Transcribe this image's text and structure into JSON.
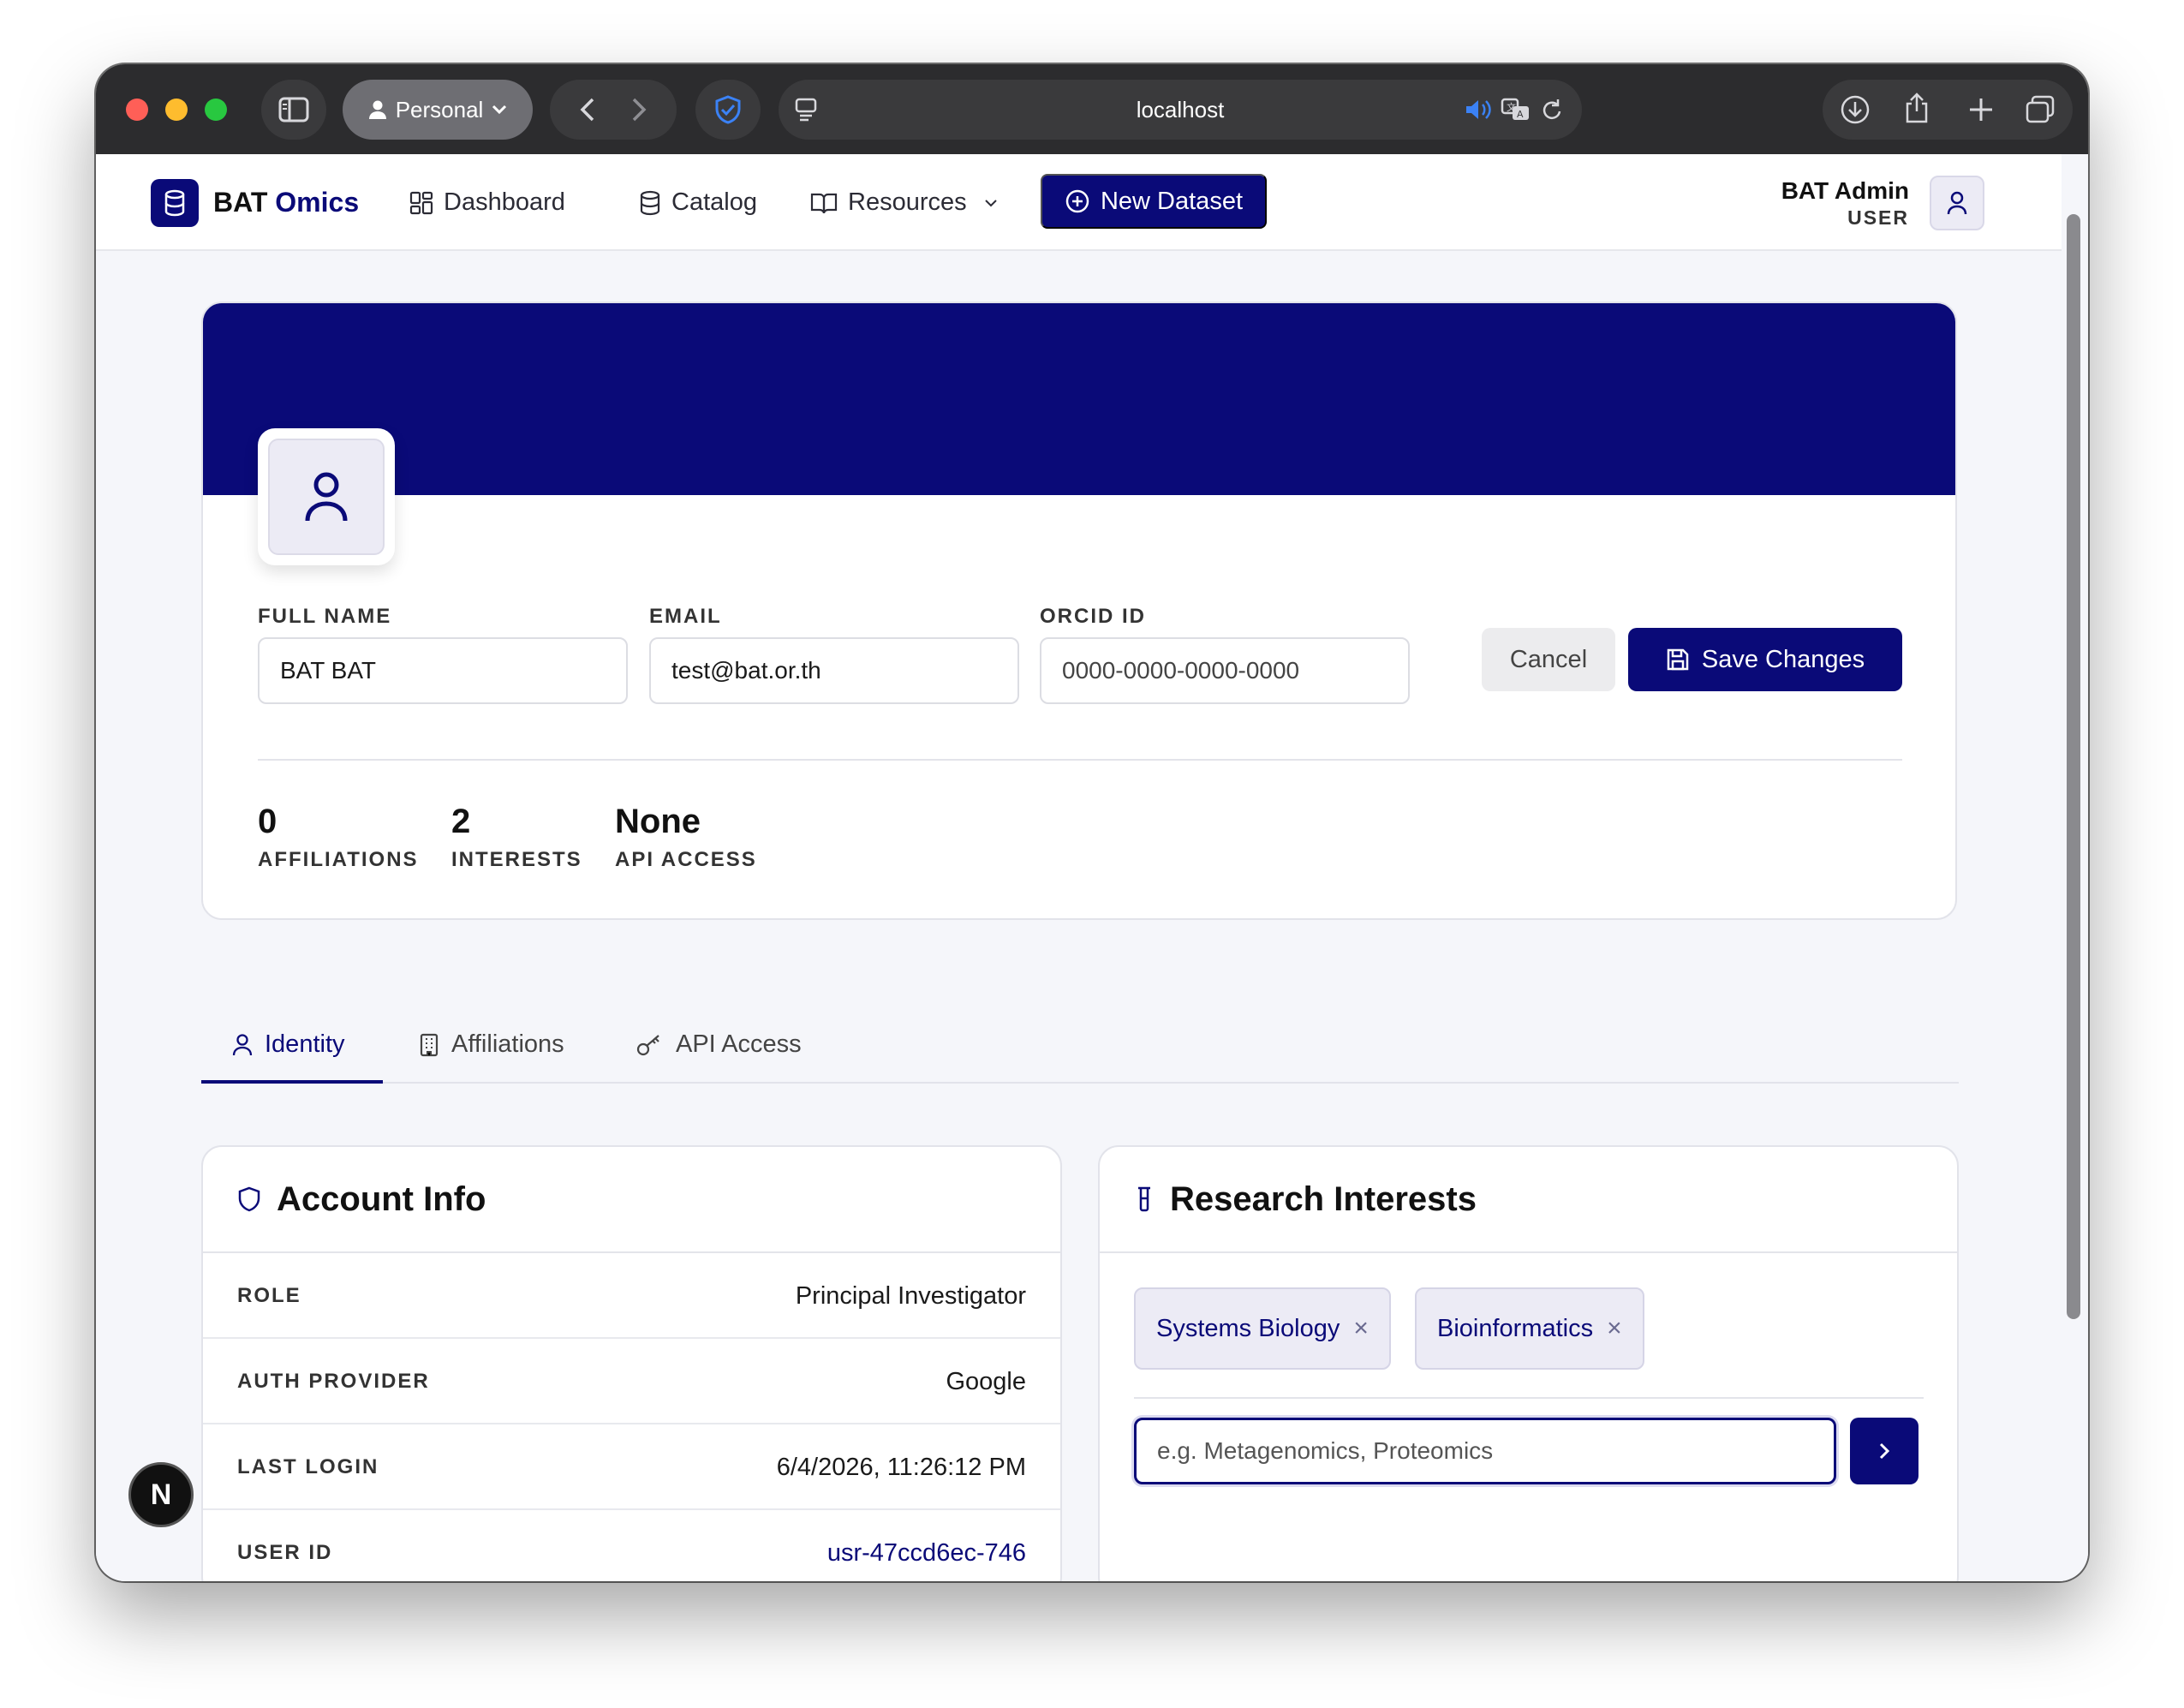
{
  "browser": {
    "profile_label": "Personal",
    "address": "localhost"
  },
  "nav": {
    "brand_prefix": "BAT",
    "brand_accent": "Omics",
    "items": [
      {
        "label": "Dashboard",
        "icon": "dashboard-grid-icon"
      },
      {
        "label": "Catalog",
        "icon": "database-icon"
      },
      {
        "label": "Resources",
        "icon": "book-icon"
      }
    ],
    "new_dataset_label": "New Dataset",
    "user_name": "BAT Admin",
    "user_role": "USER"
  },
  "profile": {
    "fields": [
      {
        "label": "FULL NAME",
        "value": "BAT BAT",
        "placeholder": ""
      },
      {
        "label": "EMAIL",
        "value": "test@bat.or.th",
        "placeholder": ""
      },
      {
        "label": "ORCID ID",
        "value": "",
        "placeholder": "0000-0000-0000-0000"
      }
    ],
    "cancel_label": "Cancel",
    "save_label": "Save Changes",
    "stats": [
      {
        "value": "0",
        "label": "AFFILIATIONS"
      },
      {
        "value": "2",
        "label": "INTERESTS"
      },
      {
        "value": "None",
        "label": "API ACCESS"
      }
    ]
  },
  "tabs": [
    {
      "label": "Identity",
      "icon": "user-icon",
      "active": true
    },
    {
      "label": "Affiliations",
      "icon": "building-icon",
      "active": false
    },
    {
      "label": "API Access",
      "icon": "key-icon",
      "active": false
    }
  ],
  "account_info": {
    "title": "Account Info",
    "rows": [
      {
        "key": "ROLE",
        "value": "Principal Investigator"
      },
      {
        "key": "AUTH PROVIDER",
        "value": "Google"
      },
      {
        "key": "LAST LOGIN",
        "value": "6/4/2026, 11:26:12 PM"
      },
      {
        "key": "USER ID",
        "value": "usr-47ccd6ec-746"
      }
    ]
  },
  "research_interests": {
    "title": "Research Interests",
    "chips": [
      "Systems Biology",
      "Bioinformatics"
    ],
    "input_placeholder": "e.g. Metagenomics, Proteomics"
  },
  "dev_badge": "N",
  "colors": {
    "brand": "#0a0a78",
    "chip_bg": "#ecebf5"
  }
}
